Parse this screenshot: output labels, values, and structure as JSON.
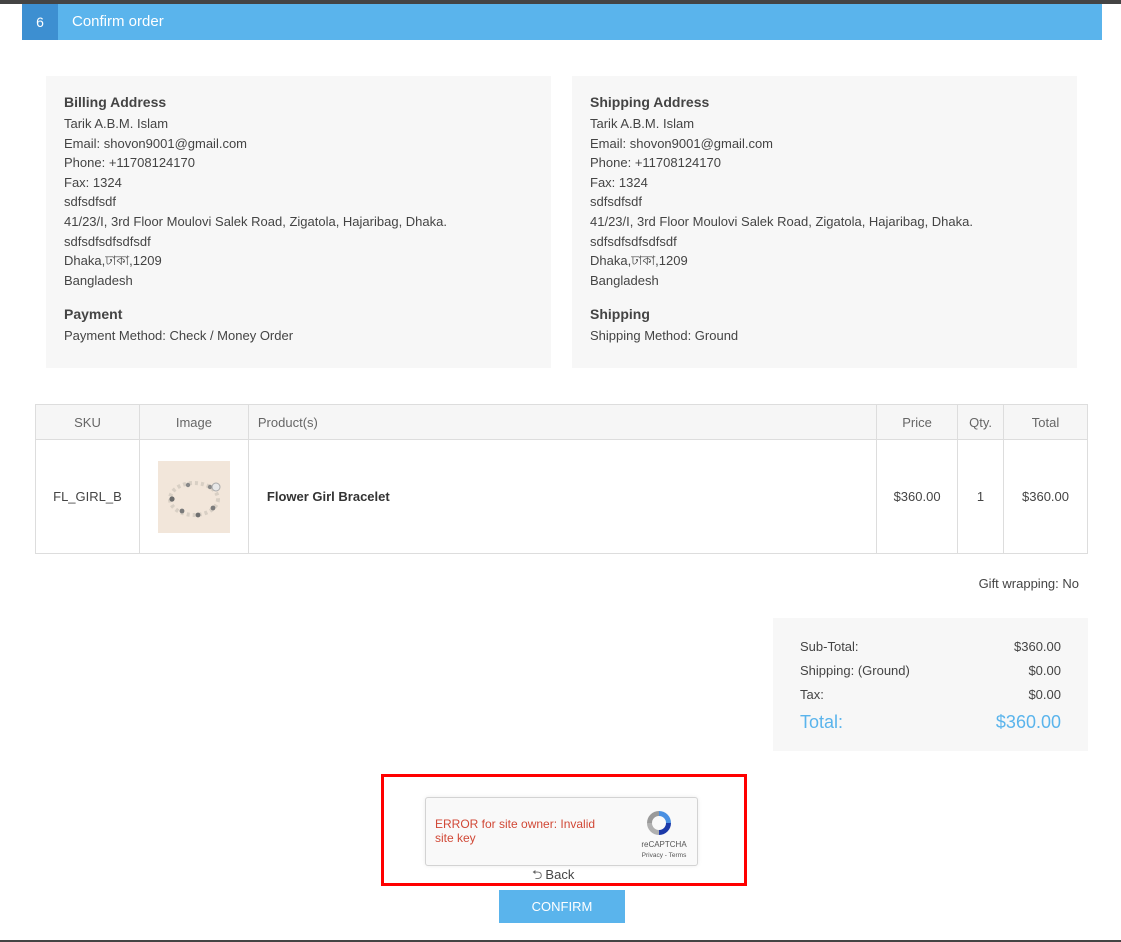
{
  "step": {
    "number": "6",
    "title": "Confirm order"
  },
  "billing": {
    "heading": "Billing Address",
    "lines": [
      "Tarik A.B.M. Islam",
      "Email: shovon9001@gmail.com",
      "Phone: +11708124170",
      "Fax: 1324",
      "sdfsdfsdf",
      "41/23/I, 3rd Floor Moulovi Salek Road, Zigatola, Hajaribag, Dhaka.",
      "sdfsdfsdfsdfsdf",
      "Dhaka,ঢাকা,1209",
      "Bangladesh"
    ]
  },
  "payment": {
    "heading": "Payment",
    "method": "Payment Method: Check / Money Order"
  },
  "shipping_address": {
    "heading": "Shipping Address",
    "lines": [
      "Tarik A.B.M. Islam",
      "Email: shovon9001@gmail.com",
      "Phone: +11708124170",
      "Fax: 1324",
      "sdfsdfsdf",
      "41/23/I, 3rd Floor Moulovi Salek Road, Zigatola, Hajaribag, Dhaka.",
      "sdfsdfsdfsdfsdf",
      "Dhaka,ঢাকা,1209",
      "Bangladesh"
    ]
  },
  "shipping": {
    "heading": "Shipping",
    "method": "Shipping Method: Ground"
  },
  "table": {
    "headers": {
      "sku": "SKU",
      "image": "Image",
      "product": "Product(s)",
      "price": "Price",
      "qty": "Qty.",
      "total": "Total"
    },
    "rows": [
      {
        "sku": "FL_GIRL_B",
        "image_icon": "bracelet-thumbnail",
        "product": "Flower Girl Bracelet",
        "price": "$360.00",
        "qty": "1",
        "total": "$360.00"
      }
    ]
  },
  "gift_wrapping": "Gift wrapping: No",
  "totals": {
    "subtotal_label": "Sub-Total:",
    "subtotal": "$360.00",
    "shipping_label": "Shipping: (Ground)",
    "shipping": "$0.00",
    "tax_label": "Tax:",
    "tax": "$0.00",
    "total_label": "Total:",
    "total": "$360.00"
  },
  "recaptcha": {
    "error": "ERROR for site owner: Invalid site key",
    "brand": "reCAPTCHA",
    "links": "Privacy - Terms",
    "icon": "recaptcha-logo-icon"
  },
  "back_label": "Back",
  "back_icon": "return-arrow-icon",
  "confirm_label": "CONFIRM",
  "colors": {
    "accent": "#5ab4ec",
    "accent_dark": "#3d8fd1",
    "highlight": "#ff0000",
    "error": "#d14836"
  }
}
